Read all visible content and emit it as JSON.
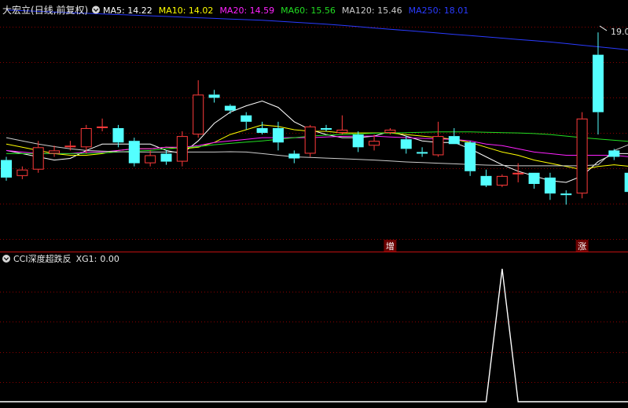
{
  "colors": {
    "background": "#000000",
    "up": "#ff3b3b",
    "down": "#54ffff",
    "grid": "#8a0000",
    "frame": "#c01010",
    "ma5": "#ffffff",
    "ma10": "#ffff00",
    "ma20": "#ff22ff",
    "ma60": "#22dd22",
    "ma120": "#cccccc",
    "ma250": "#2a3bff",
    "xg1_line": "#ffffff",
    "marker_bg": "#6a0000"
  },
  "legend": {
    "stock": "大宏立",
    "mode": "(日线,前复权)",
    "collapse_icon": "circle-chevron-down-icon",
    "ma": [
      {
        "label": "MA5:",
        "value": "14.22",
        "color": "#ffffff"
      },
      {
        "label": "MA10:",
        "value": "14.02",
        "color": "#ffff00"
      },
      {
        "label": "MA20:",
        "value": "14.59",
        "color": "#ff22ff"
      },
      {
        "label": "MA60:",
        "value": "15.56",
        "color": "#22dd22"
      },
      {
        "label": "MA120:",
        "value": "15.46",
        "color": "#cccccc"
      },
      {
        "label": "MA250:",
        "value": "18.01",
        "color": "#2a3bff"
      }
    ]
  },
  "indicator": {
    "name": "CCI深度超跌反",
    "xg_label": "XG1:",
    "xg_value": "0.00",
    "collapse_icon": "circle-chevron-down-icon"
  },
  "chart_data": [
    {
      "type": "candlestick",
      "title": "大宏立 (日线,前复权)",
      "ylim": [
        12.5,
        19.4
      ],
      "high_label": "19.0",
      "markers": [
        {
          "index": 24,
          "label": "增"
        },
        {
          "index": 36,
          "label": "涨"
        }
      ],
      "candles": [
        {
          "o": 15.0,
          "h": 15.1,
          "l": 14.35,
          "c": 14.45
        },
        {
          "o": 14.5,
          "h": 14.8,
          "l": 14.4,
          "c": 14.7
        },
        {
          "o": 14.7,
          "h": 15.6,
          "l": 14.6,
          "c": 15.4
        },
        {
          "o": 15.2,
          "h": 15.45,
          "l": 15.1,
          "c": 15.3
        },
        {
          "o": 15.4,
          "h": 15.6,
          "l": 15.3,
          "c": 15.45
        },
        {
          "o": 15.4,
          "h": 16.1,
          "l": 15.2,
          "c": 16.0
        },
        {
          "o": 16.05,
          "h": 16.3,
          "l": 15.9,
          "c": 16.05
        },
        {
          "o": 16.0,
          "h": 16.1,
          "l": 15.4,
          "c": 15.55
        },
        {
          "o": 15.6,
          "h": 15.7,
          "l": 14.8,
          "c": 14.9
        },
        {
          "o": 14.9,
          "h": 15.3,
          "l": 14.8,
          "c": 15.15
        },
        {
          "o": 15.2,
          "h": 15.3,
          "l": 14.85,
          "c": 14.95
        },
        {
          "o": 14.95,
          "h": 15.9,
          "l": 14.8,
          "c": 15.75
        },
        {
          "o": 15.8,
          "h": 17.5,
          "l": 15.7,
          "c": 17.05
        },
        {
          "o": 17.05,
          "h": 17.2,
          "l": 16.8,
          "c": 16.95
        },
        {
          "o": 16.7,
          "h": 16.75,
          "l": 16.45,
          "c": 16.55
        },
        {
          "o": 16.4,
          "h": 16.5,
          "l": 15.95,
          "c": 16.2
        },
        {
          "o": 16.0,
          "h": 16.2,
          "l": 15.8,
          "c": 15.85
        },
        {
          "o": 16.0,
          "h": 16.2,
          "l": 15.3,
          "c": 15.55
        },
        {
          "o": 15.2,
          "h": 15.3,
          "l": 14.9,
          "c": 15.05
        },
        {
          "o": 15.2,
          "h": 16.1,
          "l": 15.1,
          "c": 16.05
        },
        {
          "o": 16.0,
          "h": 16.1,
          "l": 15.9,
          "c": 15.95
        },
        {
          "o": 15.85,
          "h": 16.4,
          "l": 15.8,
          "c": 15.95
        },
        {
          "o": 15.8,
          "h": 15.9,
          "l": 15.25,
          "c": 15.4
        },
        {
          "o": 15.45,
          "h": 15.8,
          "l": 15.3,
          "c": 15.6
        },
        {
          "o": 15.85,
          "h": 16.0,
          "l": 15.8,
          "c": 15.95
        },
        {
          "o": 15.65,
          "h": 15.75,
          "l": 15.2,
          "c": 15.35
        },
        {
          "o": 15.25,
          "h": 15.4,
          "l": 15.1,
          "c": 15.2
        },
        {
          "o": 15.15,
          "h": 16.2,
          "l": 15.1,
          "c": 15.75
        },
        {
          "o": 15.75,
          "h": 16.0,
          "l": 15.5,
          "c": 15.5
        },
        {
          "o": 15.55,
          "h": 15.6,
          "l": 14.5,
          "c": 14.65
        },
        {
          "o": 14.5,
          "h": 14.7,
          "l": 14.15,
          "c": 14.2
        },
        {
          "o": 14.2,
          "h": 14.55,
          "l": 14.15,
          "c": 14.5
        },
        {
          "o": 14.55,
          "h": 14.9,
          "l": 14.3,
          "c": 14.6
        },
        {
          "o": 14.6,
          "h": 14.6,
          "l": 14.1,
          "c": 14.25
        },
        {
          "o": 14.45,
          "h": 14.6,
          "l": 13.75,
          "c": 13.95
        },
        {
          "o": 13.95,
          "h": 14.05,
          "l": 13.6,
          "c": 13.9
        },
        {
          "o": 13.95,
          "h": 16.5,
          "l": 13.8,
          "c": 16.3
        },
        {
          "o": 18.3,
          "h": 19.0,
          "l": 15.8,
          "c": 16.5
        },
        {
          "o": 15.3,
          "h": 15.35,
          "l": 15.0,
          "c": 15.1
        },
        {
          "o": 14.6,
          "h": 14.7,
          "l": 14.0,
          "c": 14.0
        }
      ],
      "series": [
        {
          "name": "MA5",
          "color": "#ffffff",
          "values": [
            15.3,
            15.2,
            15.1,
            15.0,
            15.05,
            15.3,
            15.5,
            15.5,
            15.5,
            15.5,
            15.3,
            15.2,
            15.6,
            16.15,
            16.5,
            16.7,
            16.85,
            16.65,
            16.2,
            15.95,
            15.8,
            15.7,
            15.7,
            15.75,
            15.9,
            15.75,
            15.6,
            15.55,
            15.55,
            15.35,
            15.1,
            14.85,
            14.65,
            14.5,
            14.35,
            14.3,
            14.5,
            14.95,
            15.2,
            15.2
          ]
        },
        {
          "name": "MA10",
          "color": "#ffff00",
          "values": [
            15.5,
            15.4,
            15.3,
            15.2,
            15.15,
            15.15,
            15.2,
            15.3,
            15.35,
            15.35,
            15.4,
            15.35,
            15.4,
            15.55,
            15.8,
            15.95,
            16.1,
            16.05,
            15.95,
            15.9,
            15.9,
            15.85,
            15.85,
            15.85,
            15.85,
            15.8,
            15.75,
            15.7,
            15.65,
            15.55,
            15.4,
            15.25,
            15.15,
            15.0,
            14.9,
            14.8,
            14.7,
            14.8,
            14.85,
            14.8
          ]
        },
        {
          "name": "MA20",
          "color": "#ff22ff",
          "values": [
            15.3,
            15.25,
            15.2,
            15.2,
            15.2,
            15.25,
            15.25,
            15.3,
            15.35,
            15.35,
            15.4,
            15.4,
            15.45,
            15.55,
            15.6,
            15.65,
            15.7,
            15.7,
            15.7,
            15.7,
            15.72,
            15.74,
            15.75,
            15.75,
            15.72,
            15.7,
            15.68,
            15.66,
            15.65,
            15.6,
            15.5,
            15.45,
            15.35,
            15.25,
            15.2,
            15.15,
            15.15,
            15.15,
            15.15,
            15.1
          ]
        },
        {
          "name": "MA60",
          "color": "#22dd22",
          "values": [
            15.2,
            15.2,
            15.2,
            15.2,
            15.2,
            15.2,
            15.22,
            15.25,
            15.28,
            15.3,
            15.35,
            15.38,
            15.42,
            15.48,
            15.52,
            15.56,
            15.6,
            15.65,
            15.7,
            15.75,
            15.78,
            15.8,
            15.82,
            15.84,
            15.85,
            15.86,
            15.87,
            15.88,
            15.88,
            15.88,
            15.87,
            15.86,
            15.85,
            15.83,
            15.8,
            15.75,
            15.7,
            15.66,
            15.62,
            15.58
          ]
        },
        {
          "name": "MA120",
          "color": "#cccccc",
          "values": [
            15.7,
            15.6,
            15.5,
            15.42,
            15.35,
            15.3,
            15.28,
            15.26,
            15.25,
            15.25,
            15.25,
            15.25,
            15.25,
            15.25,
            15.26,
            15.25,
            15.2,
            15.15,
            15.1,
            15.08,
            15.06,
            15.04,
            15.02,
            15.0,
            14.97,
            14.94,
            14.92,
            14.9,
            14.88,
            14.86,
            14.84,
            14.83,
            14.82,
            14.82,
            14.82,
            14.82,
            14.82,
            14.85,
            15.3,
            15.5
          ]
        },
        {
          "name": "MA250",
          "color": "#2a3bff",
          "values": [
            19.7,
            19.68,
            19.66,
            19.64,
            19.62,
            19.6,
            19.58,
            19.56,
            19.54,
            19.52,
            19.5,
            19.48,
            19.46,
            19.44,
            19.42,
            19.4,
            19.38,
            19.35,
            19.32,
            19.29,
            19.26,
            19.22,
            19.18,
            19.14,
            19.1,
            19.06,
            19.02,
            18.98,
            18.94,
            18.9,
            18.86,
            18.82,
            18.78,
            18.74,
            18.7,
            18.65,
            18.6,
            18.55,
            18.5,
            18.45
          ]
        }
      ]
    },
    {
      "type": "line",
      "title": "CCI深度超跌反",
      "name": "XG1",
      "ylim": [
        0,
        1
      ],
      "values": [
        0,
        0,
        0,
        0,
        0,
        0,
        0,
        0,
        0,
        0,
        0,
        0,
        0,
        0,
        0,
        0,
        0,
        0,
        0,
        0,
        0,
        0,
        0,
        0,
        0,
        0,
        0,
        0,
        0,
        0,
        0,
        1,
        0,
        0,
        0,
        0,
        0,
        0,
        0,
        0
      ]
    }
  ]
}
